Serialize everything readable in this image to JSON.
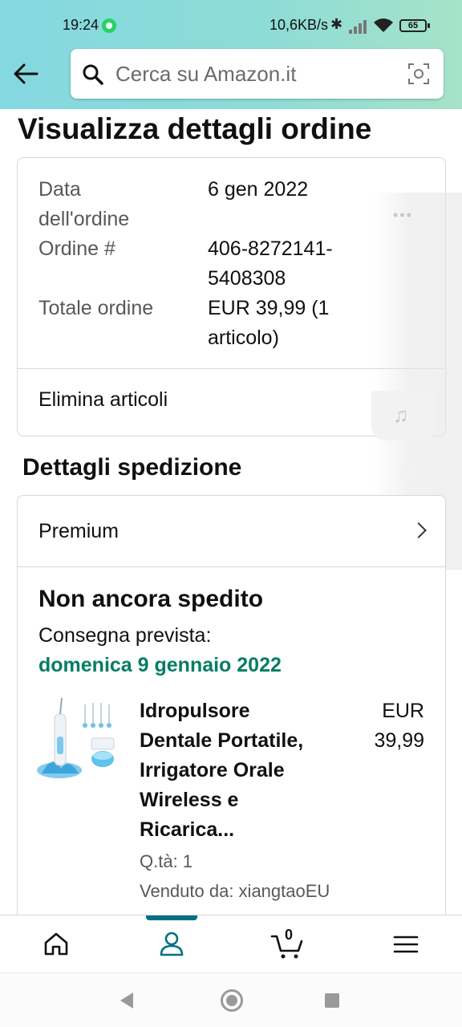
{
  "status_bar": {
    "time": "19:24",
    "network_speed": "10,6KB/s",
    "battery": "65",
    "icons": [
      "whatsapp-icon",
      "bluetooth-icon",
      "signal-icon",
      "wifi-icon",
      "battery-icon"
    ]
  },
  "search": {
    "placeholder": "Cerca su Amazon.it"
  },
  "page": {
    "title": "Visualizza dettagli ordine"
  },
  "order": {
    "date_label_line1": "Data",
    "date_label_line2": "dell'ordine",
    "date_value": "6 gen 2022",
    "number_label": "Ordine #",
    "number_value_line1": "406-8272141-",
    "number_value_line2": "5408308",
    "total_label": "Totale ordine",
    "total_value_line1": "EUR 39,99 (1",
    "total_value_line2": "articolo)",
    "delete_items_label": "Elimina articoli"
  },
  "shipping": {
    "section_title": "Dettagli spedizione",
    "premium_label": "Premium",
    "status": "Non ancora spedito",
    "delivery_label": "Consegna prevista:",
    "delivery_date": "domenica 9 gennaio 2022",
    "product": {
      "title_lines": [
        "Idropulsore",
        "Dentale Portatile,",
        "Irrigatore Orale",
        "Wireless e",
        "Ricarica..."
      ],
      "price_line1": "EUR",
      "price_line2": "39,99",
      "quantity": "Q.tà: 1",
      "seller": "Venduto da: xiangtaoEU"
    }
  },
  "bottom_nav": {
    "cart_count": "0",
    "items": [
      "home-icon",
      "account-icon",
      "cart-icon",
      "menu-icon"
    ],
    "active": "account"
  },
  "colors": {
    "header_gradient_start": "#84d8e0",
    "header_gradient_end": "#a6e3c8",
    "delivery_green": "#067d62",
    "nav_active": "#007185"
  }
}
